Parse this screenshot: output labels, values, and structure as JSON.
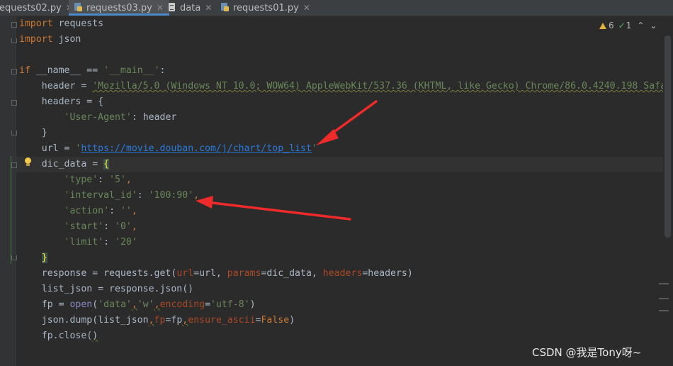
{
  "tabs": [
    {
      "label": "requests02.py",
      "active": false,
      "icon": "python-file-icon"
    },
    {
      "label": "requests03.py",
      "active": true,
      "icon": "python-file-icon"
    },
    {
      "label": "data",
      "active": false,
      "icon": "text-file-icon"
    },
    {
      "label": "requests01.py",
      "active": false,
      "icon": "python-file-icon"
    }
  ],
  "inspection": {
    "warnings": "6",
    "weak_warnings": "1"
  },
  "code": {
    "l1": {
      "kw": "import",
      "rest": " requests"
    },
    "l2": {
      "kw": "import",
      "rest": " json"
    },
    "l4": {
      "kw": "if",
      "mid": " __name__ == ",
      "str": "'__main__'",
      "end": ":"
    },
    "l5": {
      "pre": "    header = ",
      "str": "'Mozilla/5.0 (Windows NT 10.0; WOW64) AppleWebKit/537.36 (KHTML, like Gecko) Chrome/86.0.4240.198 Safa"
    },
    "l6": {
      "text": "    headers = {"
    },
    "l7": {
      "pre": "        ",
      "str": "'User-Agent'",
      "end": ": header"
    },
    "l8": {
      "text": "    }"
    },
    "l9": {
      "pre": "    url = ",
      "q1": "'",
      "url": "https://movie.douban.com/j/chart/top_list",
      "q2": "'"
    },
    "l10": {
      "pre": "    dic_data = ",
      "brace": "{"
    },
    "l11": {
      "pre": "        ",
      "k": "'type'",
      "sep": ": ",
      "v": "'5'",
      "end": ","
    },
    "l12": {
      "pre": "        ",
      "k": "'interval_id'",
      "sep": ": ",
      "v": "'100:90'",
      "end": ","
    },
    "l13": {
      "pre": "        ",
      "k": "'action'",
      "sep": ": ",
      "v": "''",
      "end": ","
    },
    "l14": {
      "pre": "        ",
      "k": "'start'",
      "sep": ": ",
      "v": "'0'",
      "end": ","
    },
    "l15": {
      "pre": "        ",
      "k": "'limit'",
      "sep": ": ",
      "v": "'20'"
    },
    "l16": {
      "pre": "    ",
      "brace": "}"
    },
    "l17": {
      "a": "    response = requests.get(",
      "p1": "url",
      "b": "=url, ",
      "p2": "params",
      "c": "=dic_data, ",
      "p3": "headers",
      "d": "=headers)"
    },
    "l18": {
      "text": "    list_json = response.json()"
    },
    "l19": {
      "a": "    fp = ",
      "open": "open",
      "b": "(",
      "s1": "'data'",
      "c1": ",",
      "s2": "'w'",
      "c2": ",",
      "p": "encoding",
      "eq": "=",
      "s3": "'utf-8'",
      "e": ")"
    },
    "l20": {
      "a": "    json.dump(list_json",
      "c1": ",",
      "p1": "fp",
      "b": "=fp",
      "c2": ",",
      "p2": "ensure_ascii",
      "eq": "=",
      "kw": "False",
      "e": ")"
    },
    "l21": {
      "a": "    fp.close(",
      "e": ")"
    }
  },
  "watermark": "CSDN @我是Tony呀~",
  "colors": {
    "background": "#2b2b2b",
    "keyword": "#cc7832",
    "string": "#6a8759",
    "param": "#aa4926",
    "arrow": "#ee2a2a"
  }
}
